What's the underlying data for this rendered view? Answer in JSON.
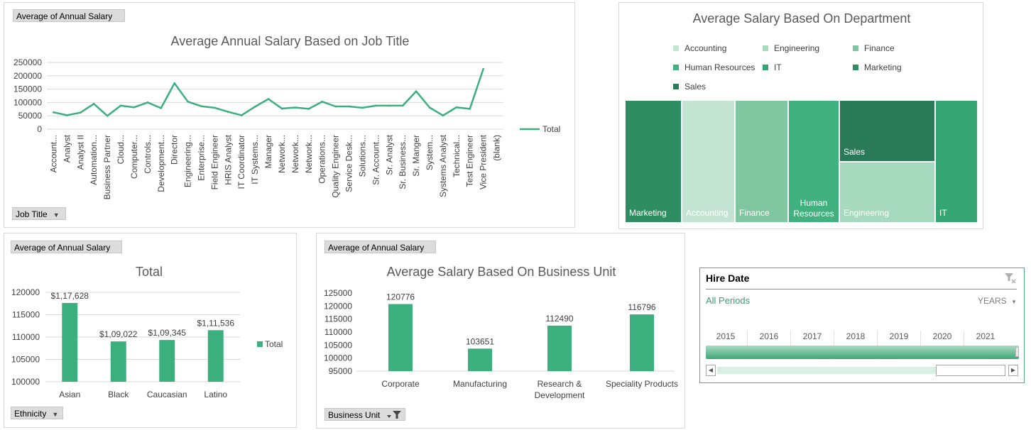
{
  "colors": {
    "accent": "#3caf7f",
    "Accounting": "#c4e4d3",
    "Engineering": "#a6d9bd",
    "Finance": "#80c6a1",
    "Human Resources": "#41b17f",
    "IT": "#36a574",
    "Marketing": "#2f8e61",
    "Sales": "#2a7a59"
  },
  "job_chart": {
    "field_button": "Average of Annual Salary",
    "axis_button": "Job Title",
    "legend": "Total"
  },
  "dept_chart": {
    "title": "Average Salary Based On Department"
  },
  "eth_chart": {
    "field_button": "Average of Annual Salary",
    "axis_button": "Ethnicity",
    "legend": "Total"
  },
  "bu_chart": {
    "field_button": "Average of Annual Salary",
    "axis_button": "Business Unit"
  },
  "slicer": {
    "title": "Hire Date",
    "all_periods": "All Periods",
    "level": "YEARS",
    "years": [
      "2015",
      "2016",
      "2017",
      "2018",
      "2019",
      "2020",
      "2021"
    ]
  },
  "chart_data": [
    {
      "type": "line",
      "title": "Average Annual Salary Based on Job Title",
      "xlabel": "",
      "ylabel": "",
      "ylim": [
        0,
        250000
      ],
      "yticks": [
        "0",
        "50000",
        "100000",
        "150000",
        "200000",
        "250000"
      ],
      "categories": [
        "Account...",
        "Analyst",
        "Analyst II",
        "Automation...",
        "Business Partner",
        "Cloud...",
        "Computer...",
        "Controls...",
        "Development...",
        "Director",
        "Engineering...",
        "Enterprise...",
        "Field Engineer",
        "HRIS Analyst",
        "IT Coordinator",
        "IT Systems...",
        "Manager",
        "Network...",
        "Network...",
        "Network...",
        "Operations...",
        "Quality Engineer",
        "Service Desk...",
        "Solutions...",
        "Sr. Account...",
        "Sr. Analyst",
        "Sr. Business...",
        "Sr. Manger",
        "System...",
        "Systems Analyst",
        "Technical...",
        "Test Engineer",
        "Vice President",
        "(blank)"
      ],
      "series": [
        {
          "name": "Total",
          "values": [
            63000,
            52000,
            62000,
            95000,
            50000,
            88000,
            82000,
            100000,
            79000,
            172000,
            103000,
            86000,
            80000,
            65000,
            52000,
            84000,
            113000,
            77000,
            81000,
            76000,
            103000,
            85000,
            85000,
            80000,
            88000,
            88000,
            88000,
            142000,
            81000,
            51000,
            82000,
            76000,
            225000,
            null
          ]
        }
      ],
      "legend": "right"
    },
    {
      "type": "treemap",
      "title": "Average Salary Based On Department",
      "categories": [
        "Marketing",
        "Accounting",
        "Finance",
        "Human Resources",
        "Sales",
        "Engineering",
        "IT"
      ],
      "legend": "top"
    },
    {
      "type": "bar",
      "title": "Total",
      "categories": [
        "Asian",
        "Black",
        "Caucasian",
        "Latino"
      ],
      "values": [
        117628,
        109022,
        109345,
        111536
      ],
      "data_labels": [
        "$1,17,628",
        "$1,09,022",
        "$1,09,345",
        "$1,11,536"
      ],
      "ylim": [
        100000,
        120000
      ],
      "yticks": [
        "100000",
        "105000",
        "110000",
        "115000",
        "120000"
      ],
      "series": [
        {
          "name": "Total",
          "values": [
            117628,
            109022,
            109345,
            111536
          ]
        }
      ],
      "xlabel": "",
      "ylabel": "",
      "legend": "right"
    },
    {
      "type": "bar",
      "title": "Average Salary Based On Business Unit",
      "categories": [
        "Corporate",
        "Manufacturing",
        "Research & Development",
        "Speciality Products"
      ],
      "category_lines": [
        [
          "Corporate"
        ],
        [
          "Manufacturing"
        ],
        [
          "Research &",
          "Development"
        ],
        [
          "Speciality Products"
        ]
      ],
      "values": [
        120776,
        103651,
        112490,
        116796
      ],
      "data_labels": [
        "120776",
        "103651",
        "112490",
        "116796"
      ],
      "ylim": [
        95000,
        125000
      ],
      "yticks": [
        "95000",
        "100000",
        "105000",
        "110000",
        "115000",
        "120000",
        "125000"
      ],
      "xlabel": "",
      "ylabel": "",
      "legend": "none"
    }
  ]
}
